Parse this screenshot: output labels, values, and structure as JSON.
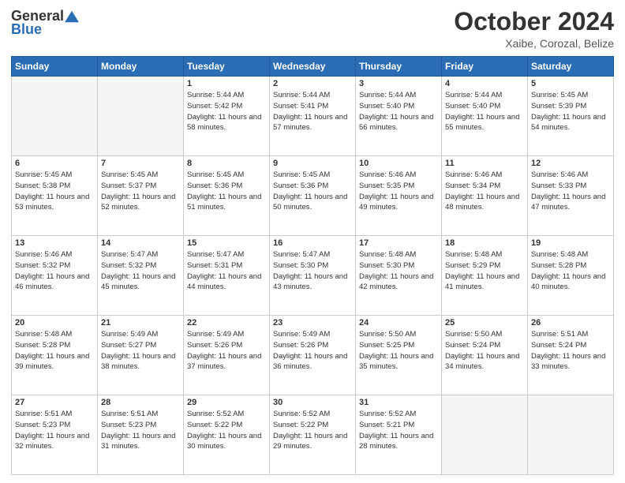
{
  "header": {
    "logo_general": "General",
    "logo_blue": "Blue",
    "main_title": "October 2024",
    "subtitle": "Xaibe, Corozal, Belize"
  },
  "days_of_week": [
    "Sunday",
    "Monday",
    "Tuesday",
    "Wednesday",
    "Thursday",
    "Friday",
    "Saturday"
  ],
  "weeks": [
    [
      {
        "day": "",
        "empty": true
      },
      {
        "day": "",
        "empty": true
      },
      {
        "day": "1",
        "sunrise": "5:44 AM",
        "sunset": "5:42 PM",
        "daylight": "11 hours and 58 minutes."
      },
      {
        "day": "2",
        "sunrise": "5:44 AM",
        "sunset": "5:41 PM",
        "daylight": "11 hours and 57 minutes."
      },
      {
        "day": "3",
        "sunrise": "5:44 AM",
        "sunset": "5:40 PM",
        "daylight": "11 hours and 56 minutes."
      },
      {
        "day": "4",
        "sunrise": "5:44 AM",
        "sunset": "5:40 PM",
        "daylight": "11 hours and 55 minutes."
      },
      {
        "day": "5",
        "sunrise": "5:45 AM",
        "sunset": "5:39 PM",
        "daylight": "11 hours and 54 minutes."
      }
    ],
    [
      {
        "day": "6",
        "sunrise": "5:45 AM",
        "sunset": "5:38 PM",
        "daylight": "11 hours and 53 minutes."
      },
      {
        "day": "7",
        "sunrise": "5:45 AM",
        "sunset": "5:37 PM",
        "daylight": "11 hours and 52 minutes."
      },
      {
        "day": "8",
        "sunrise": "5:45 AM",
        "sunset": "5:36 PM",
        "daylight": "11 hours and 51 minutes."
      },
      {
        "day": "9",
        "sunrise": "5:45 AM",
        "sunset": "5:36 PM",
        "daylight": "11 hours and 50 minutes."
      },
      {
        "day": "10",
        "sunrise": "5:46 AM",
        "sunset": "5:35 PM",
        "daylight": "11 hours and 49 minutes."
      },
      {
        "day": "11",
        "sunrise": "5:46 AM",
        "sunset": "5:34 PM",
        "daylight": "11 hours and 48 minutes."
      },
      {
        "day": "12",
        "sunrise": "5:46 AM",
        "sunset": "5:33 PM",
        "daylight": "11 hours and 47 minutes."
      }
    ],
    [
      {
        "day": "13",
        "sunrise": "5:46 AM",
        "sunset": "5:32 PM",
        "daylight": "11 hours and 46 minutes."
      },
      {
        "day": "14",
        "sunrise": "5:47 AM",
        "sunset": "5:32 PM",
        "daylight": "11 hours and 45 minutes."
      },
      {
        "day": "15",
        "sunrise": "5:47 AM",
        "sunset": "5:31 PM",
        "daylight": "11 hours and 44 minutes."
      },
      {
        "day": "16",
        "sunrise": "5:47 AM",
        "sunset": "5:30 PM",
        "daylight": "11 hours and 43 minutes."
      },
      {
        "day": "17",
        "sunrise": "5:48 AM",
        "sunset": "5:30 PM",
        "daylight": "11 hours and 42 minutes."
      },
      {
        "day": "18",
        "sunrise": "5:48 AM",
        "sunset": "5:29 PM",
        "daylight": "11 hours and 41 minutes."
      },
      {
        "day": "19",
        "sunrise": "5:48 AM",
        "sunset": "5:28 PM",
        "daylight": "11 hours and 40 minutes."
      }
    ],
    [
      {
        "day": "20",
        "sunrise": "5:48 AM",
        "sunset": "5:28 PM",
        "daylight": "11 hours and 39 minutes."
      },
      {
        "day": "21",
        "sunrise": "5:49 AM",
        "sunset": "5:27 PM",
        "daylight": "11 hours and 38 minutes."
      },
      {
        "day": "22",
        "sunrise": "5:49 AM",
        "sunset": "5:26 PM",
        "daylight": "11 hours and 37 minutes."
      },
      {
        "day": "23",
        "sunrise": "5:49 AM",
        "sunset": "5:26 PM",
        "daylight": "11 hours and 36 minutes."
      },
      {
        "day": "24",
        "sunrise": "5:50 AM",
        "sunset": "5:25 PM",
        "daylight": "11 hours and 35 minutes."
      },
      {
        "day": "25",
        "sunrise": "5:50 AM",
        "sunset": "5:24 PM",
        "daylight": "11 hours and 34 minutes."
      },
      {
        "day": "26",
        "sunrise": "5:51 AM",
        "sunset": "5:24 PM",
        "daylight": "11 hours and 33 minutes."
      }
    ],
    [
      {
        "day": "27",
        "sunrise": "5:51 AM",
        "sunset": "5:23 PM",
        "daylight": "11 hours and 32 minutes."
      },
      {
        "day": "28",
        "sunrise": "5:51 AM",
        "sunset": "5:23 PM",
        "daylight": "11 hours and 31 minutes."
      },
      {
        "day": "29",
        "sunrise": "5:52 AM",
        "sunset": "5:22 PM",
        "daylight": "11 hours and 30 minutes."
      },
      {
        "day": "30",
        "sunrise": "5:52 AM",
        "sunset": "5:22 PM",
        "daylight": "11 hours and 29 minutes."
      },
      {
        "day": "31",
        "sunrise": "5:52 AM",
        "sunset": "5:21 PM",
        "daylight": "11 hours and 28 minutes."
      },
      {
        "day": "",
        "empty": true
      },
      {
        "day": "",
        "empty": true
      }
    ]
  ]
}
